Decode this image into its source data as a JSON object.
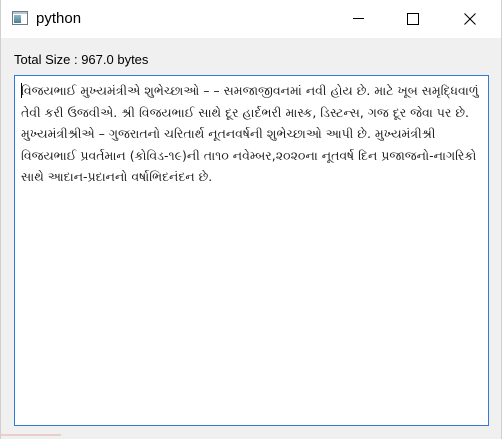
{
  "window": {
    "title": "python",
    "icon": "python-window-icon",
    "controls": {
      "minimize": "minimize-icon",
      "maximize": "maximize-icon",
      "close": "close-icon"
    }
  },
  "main": {
    "size_label": "Total Size : 967.0 bytes",
    "text_content": "વિજયભાઈ મુખ્યમંત્રીએ શુભેચ્છાઓ – – સમજાજીવનમાં નવી હોય છે. માટે ખૂબ સમૃદ્ધિવાળું તેવી કરી ઉજવીએ. શ્રી વિજયભાઈ સાથે દૂર હાર્દભરી માસ્ક, ડિસ્ટન્સ, ગજ દૂર જેવા પર છે. મુખ્યમંત્રીશ્રીએ – ગુજરાતનો ચરિતાર્થ નૂતનવર્ષની શુભેચ્છાઓ આપી છે. મુખ્યમંત્રીશ્રી વિજયભાઈ પ્રવર્તમાન (કોવિડ-૧૯)ની તા૧૦ નવેમ્બર,૨૦૨૦ના નૂતવર્ષ દિન પ્રજાજનો-નાગરિકો સાથે આદાન-પ્રદાનનો વર્ષાભિદનંદન છે."
  }
}
